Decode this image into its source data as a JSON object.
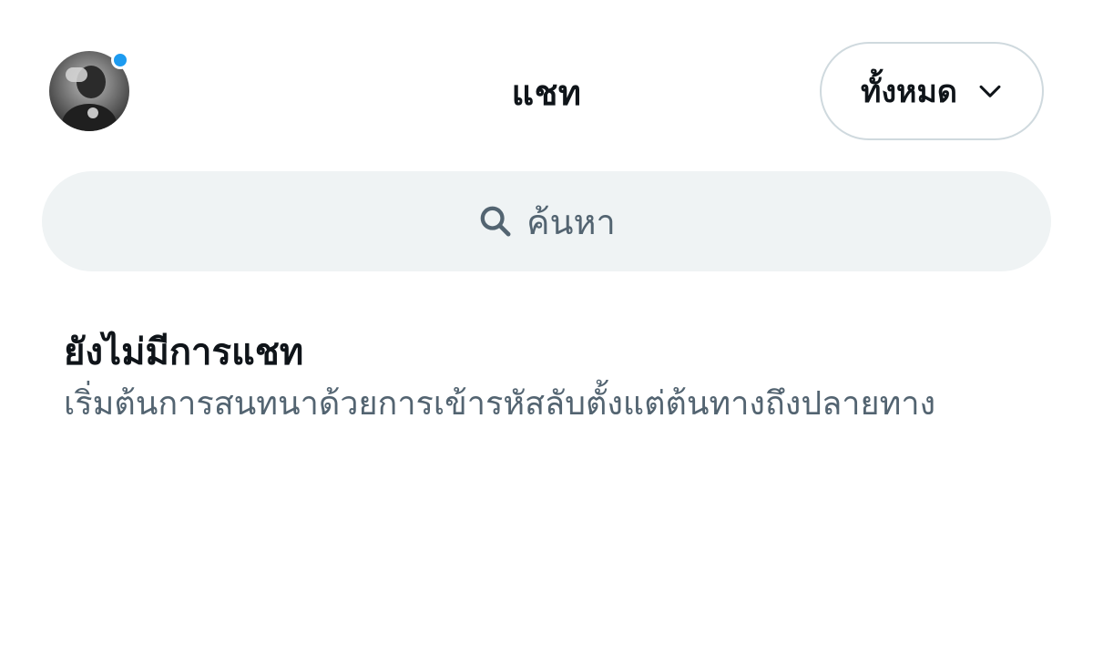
{
  "header": {
    "title": "แชท",
    "filter_label": "ทั้งหมด",
    "avatar_icon": "user-avatar",
    "status_color": "#1d9bf0",
    "chevron_icon": "chevron-down-icon"
  },
  "search": {
    "placeholder": "ค้นหา",
    "icon": "search-icon"
  },
  "empty_state": {
    "title": "ยังไม่มีการแชท",
    "description": "เริ่มต้นการสนทนาด้วยการเข้ารหัสลับตั้งแต่ต้นทางถึงปลายทาง"
  }
}
